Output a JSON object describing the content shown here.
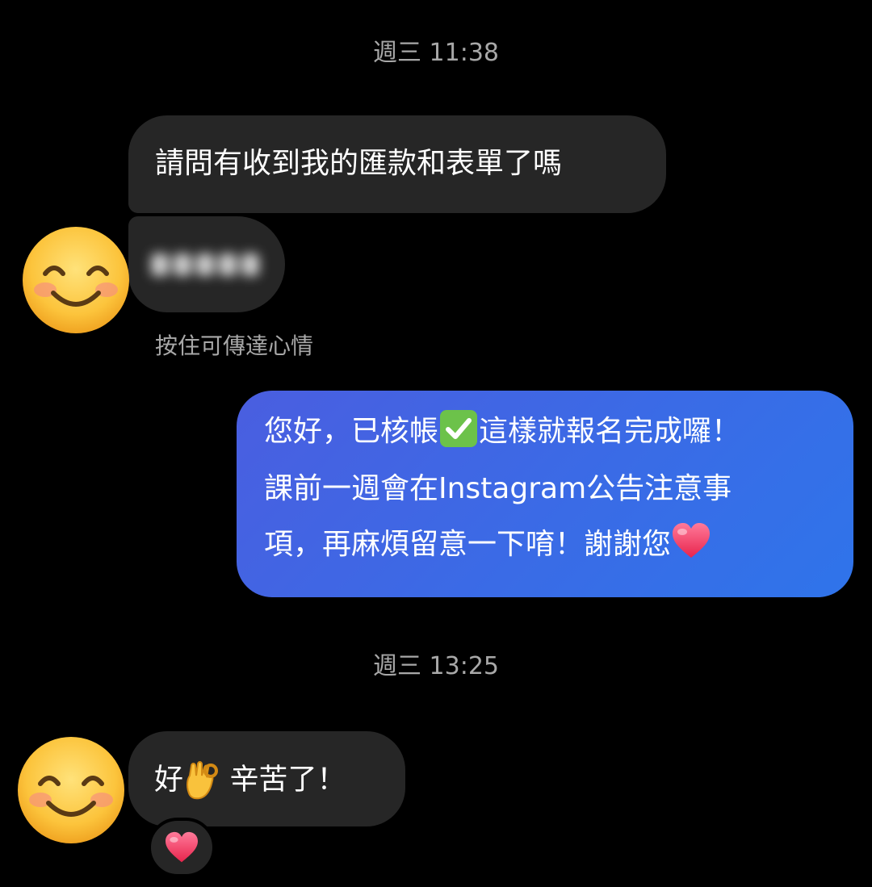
{
  "messages": {
    "timestamp_1": "週三 11:38",
    "incoming_1": "請問有收到我的匯款和表單了嗎",
    "hint": "按住可傳達心情",
    "outgoing_line_1a": "您好，已核帳",
    "outgoing_line_1b": "這樣就報名完成囉！",
    "outgoing_line_2": "課前一週會在Instagram公告注意事",
    "outgoing_line_3": "項，再麻煩留意一下唷！謝謝您",
    "timestamp_2": "週三 13:25",
    "incoming_2a": "好",
    "incoming_2b": " 辛苦了！"
  },
  "icons": {
    "avatar": "smiling-face-icon",
    "check": "check-mark-button-icon",
    "heart": "red-heart-icon",
    "ok": "ok-hand-icon",
    "reaction": "red-heart-icon"
  },
  "colors": {
    "background": "#000000",
    "incoming_bubble": "#262626",
    "outgoing_bubble": "#3f66e4",
    "timestamp": "#a8a8a8"
  }
}
